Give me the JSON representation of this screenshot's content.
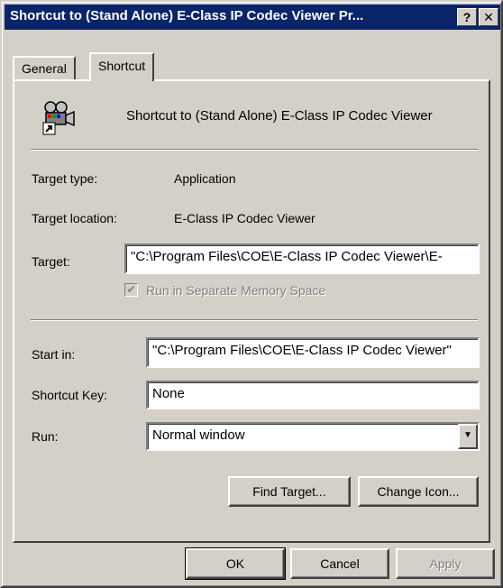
{
  "window": {
    "title": "Shortcut to  (Stand Alone) E-Class IP Codec Viewer Pr...",
    "help_button": "?",
    "close_button": "✕"
  },
  "tabs": [
    {
      "label": "General",
      "active": false
    },
    {
      "label": "Shortcut",
      "active": true
    }
  ],
  "shortcut": {
    "icon": "video-camera-shortcut-icon",
    "name": "Shortcut to  (Stand Alone) E-Class IP Codec Viewer",
    "target_type_label": "Target type:",
    "target_type_value": "Application",
    "target_location_label": "Target location:",
    "target_location_value": "E-Class IP Codec Viewer",
    "target_label": "Target:",
    "target_value": "\"C:\\Program Files\\COE\\E-Class IP Codec Viewer\\E-",
    "separate_memory_label": "Run in Separate Memory Space",
    "separate_memory_checked": true,
    "start_in_label": "Start in:",
    "start_in_value": "\"C:\\Program Files\\COE\\E-Class IP Codec Viewer\"",
    "shortcut_key_label": "Shortcut Key:",
    "shortcut_key_value": "None",
    "run_label": "Run:",
    "run_value": "Normal window",
    "find_target_label": "Find Target...",
    "change_icon_label": "Change Icon..."
  },
  "footer": {
    "ok_label": "OK",
    "cancel_label": "Cancel",
    "apply_label": "Apply"
  }
}
